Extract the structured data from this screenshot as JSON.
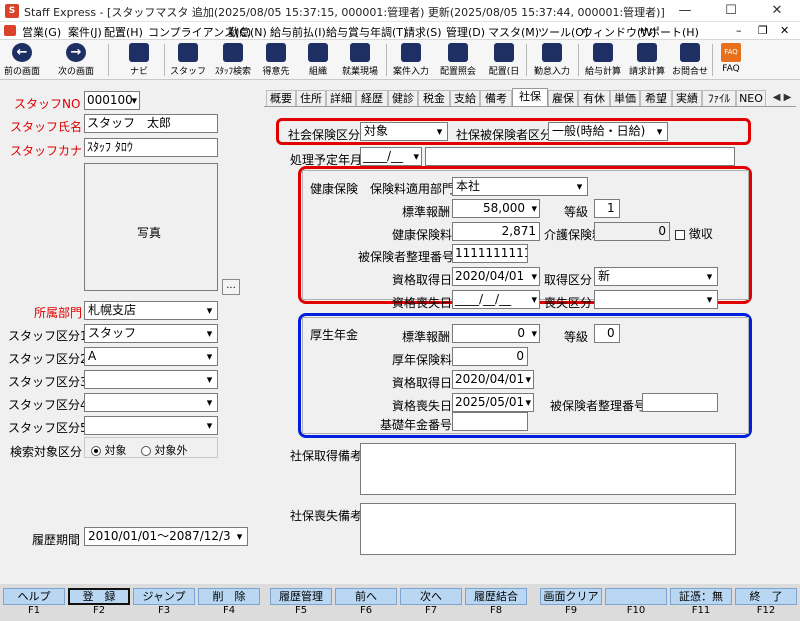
{
  "window": {
    "title": "Staff Express - [スタッフマスタ 追加(2025/08/05 15:37:15, 000001:管理者) 更新(2025/08/05 15:37:44, 000001:管理者)]",
    "app_icon": "S",
    "minimize": "—",
    "maximize": "☐",
    "close": "✕"
  },
  "menu": [
    "営業(G)",
    "案件(J)",
    "配置(H)",
    "コンプライアンス(C)",
    "勤怠(N)",
    "給与前払(I)",
    "給与賞与年調(T)",
    "請求(S)",
    "管理(D)",
    "マスタ(M)",
    "ツール(O)",
    "ウィンドウ(W)",
    "サポート(H)"
  ],
  "mdi": {
    "minimize": "–",
    "restore": "❐",
    "close": "✕"
  },
  "toolbar": {
    "prev": "前の画面",
    "next": "次の画面",
    "navi": "ナビ",
    "staff": "スタッフ",
    "staff_search": "ｽﾀｯﾌ検索",
    "client": "得意先",
    "org": "組織",
    "site": "就業現場",
    "case_input": "案件入力",
    "placement_ref": "配置照会",
    "placement_day": "配置(日",
    "attendance": "勤怠入力",
    "payroll": "給与計算",
    "billing": "請求計算",
    "contact": "お問合せ",
    "faq": "FAQ",
    "faq_icon": "FAQ"
  },
  "left": {
    "staff_no_label": "スタッフNO",
    "staff_no": "000100",
    "name_label": "スタッフ氏名",
    "name": "スタッフ　太郎",
    "kana_label": "スタッフカナ",
    "kana": "ｽﾀｯﾌ ﾀﾛｳ",
    "photo_label": "写真",
    "photo_button": "...",
    "dept_label": "所属部門",
    "dept": "札幌支店",
    "class1_label": "スタッフ区分1",
    "class1": "スタッフ",
    "class2_label": "スタッフ区分2",
    "class2": "A",
    "class3_label": "スタッフ区分3",
    "class3": "",
    "class4_label": "スタッフ区分4",
    "class4": "",
    "class5_label": "スタッフ区分5",
    "class5": "",
    "search_label": "検索対象区分",
    "search_yes": "対象",
    "search_no": "対象外",
    "history_label": "履歴期間",
    "history": "2010/01/01～2087/12/31"
  },
  "tabs": [
    "概要",
    "住所",
    "詳細",
    "経歴",
    "健診",
    "税金",
    "支給",
    "備考",
    "社保",
    "雇保",
    "有休",
    "単価",
    "希望",
    "実績",
    "ﾌｧｲﾙ",
    "NEO"
  ],
  "active_tab": "社保",
  "social": {
    "category_label": "社会保険区分",
    "category": "対象",
    "insured_label": "社保被保険者区分",
    "insured": "一般(時給・日給)",
    "planned_label": "処理予定年月",
    "planned": "____/__",
    "health": {
      "title": "健康保険",
      "dept_label": "保険料適用部門",
      "dept": "本社",
      "std_label": "標準報酬",
      "std": "58,000",
      "grade_label": "等級",
      "grade": "1",
      "premium_label": "健康保険料",
      "premium": "2,871",
      "care_label": "介護保険料",
      "care": "0",
      "exempt_label": "徴収",
      "number_label": "被保険者整理番号",
      "number": "1111111111",
      "acq_date_label": "資格取得日",
      "acq_date": "2020/04/01",
      "acq_type_label": "取得区分",
      "acq_type": "新",
      "loss_date_label": "資格喪失日",
      "loss_date": "____/__/__",
      "loss_type_label": "喪失区分",
      "loss_type": ""
    },
    "pension": {
      "title": "厚生年金",
      "std_label": "標準報酬",
      "std": "0",
      "grade_label": "等級",
      "grade": "0",
      "premium_label": "厚年保険料",
      "premium": "0",
      "acq_date_label": "資格取得日",
      "acq_date": "2020/04/01",
      "loss_date_label": "資格喪失日",
      "loss_date": "2025/05/01",
      "number_label": "被保険者整理番号",
      "number": "",
      "basic_label": "基礎年金番号",
      "basic": ""
    },
    "acq_note_label": "社保取得備考",
    "acq_note": "",
    "loss_note_label": "社保喪失備考",
    "loss_note": ""
  },
  "fkeys": [
    {
      "label": "ヘルプ",
      "key": "F1"
    },
    {
      "label": "登　録",
      "key": "F2"
    },
    {
      "label": "ジャンプ",
      "key": "F3"
    },
    {
      "label": "削　除",
      "key": "F4"
    },
    {
      "label": "履歴管理",
      "key": "F5"
    },
    {
      "label": "前へ",
      "key": "F6"
    },
    {
      "label": "次へ",
      "key": "F7"
    },
    {
      "label": "履歴結合",
      "key": "F8"
    },
    {
      "label": "画面クリア",
      "key": "F9"
    },
    {
      "label": "",
      "key": "F10"
    },
    {
      "label": "証憑：無",
      "key": "F11"
    },
    {
      "label": "終　了",
      "key": "F12"
    }
  ],
  "colors": {
    "highlight_red": "#e00000",
    "highlight_blue": "#0020e0",
    "fkey_bg": "#b9d7f2"
  }
}
